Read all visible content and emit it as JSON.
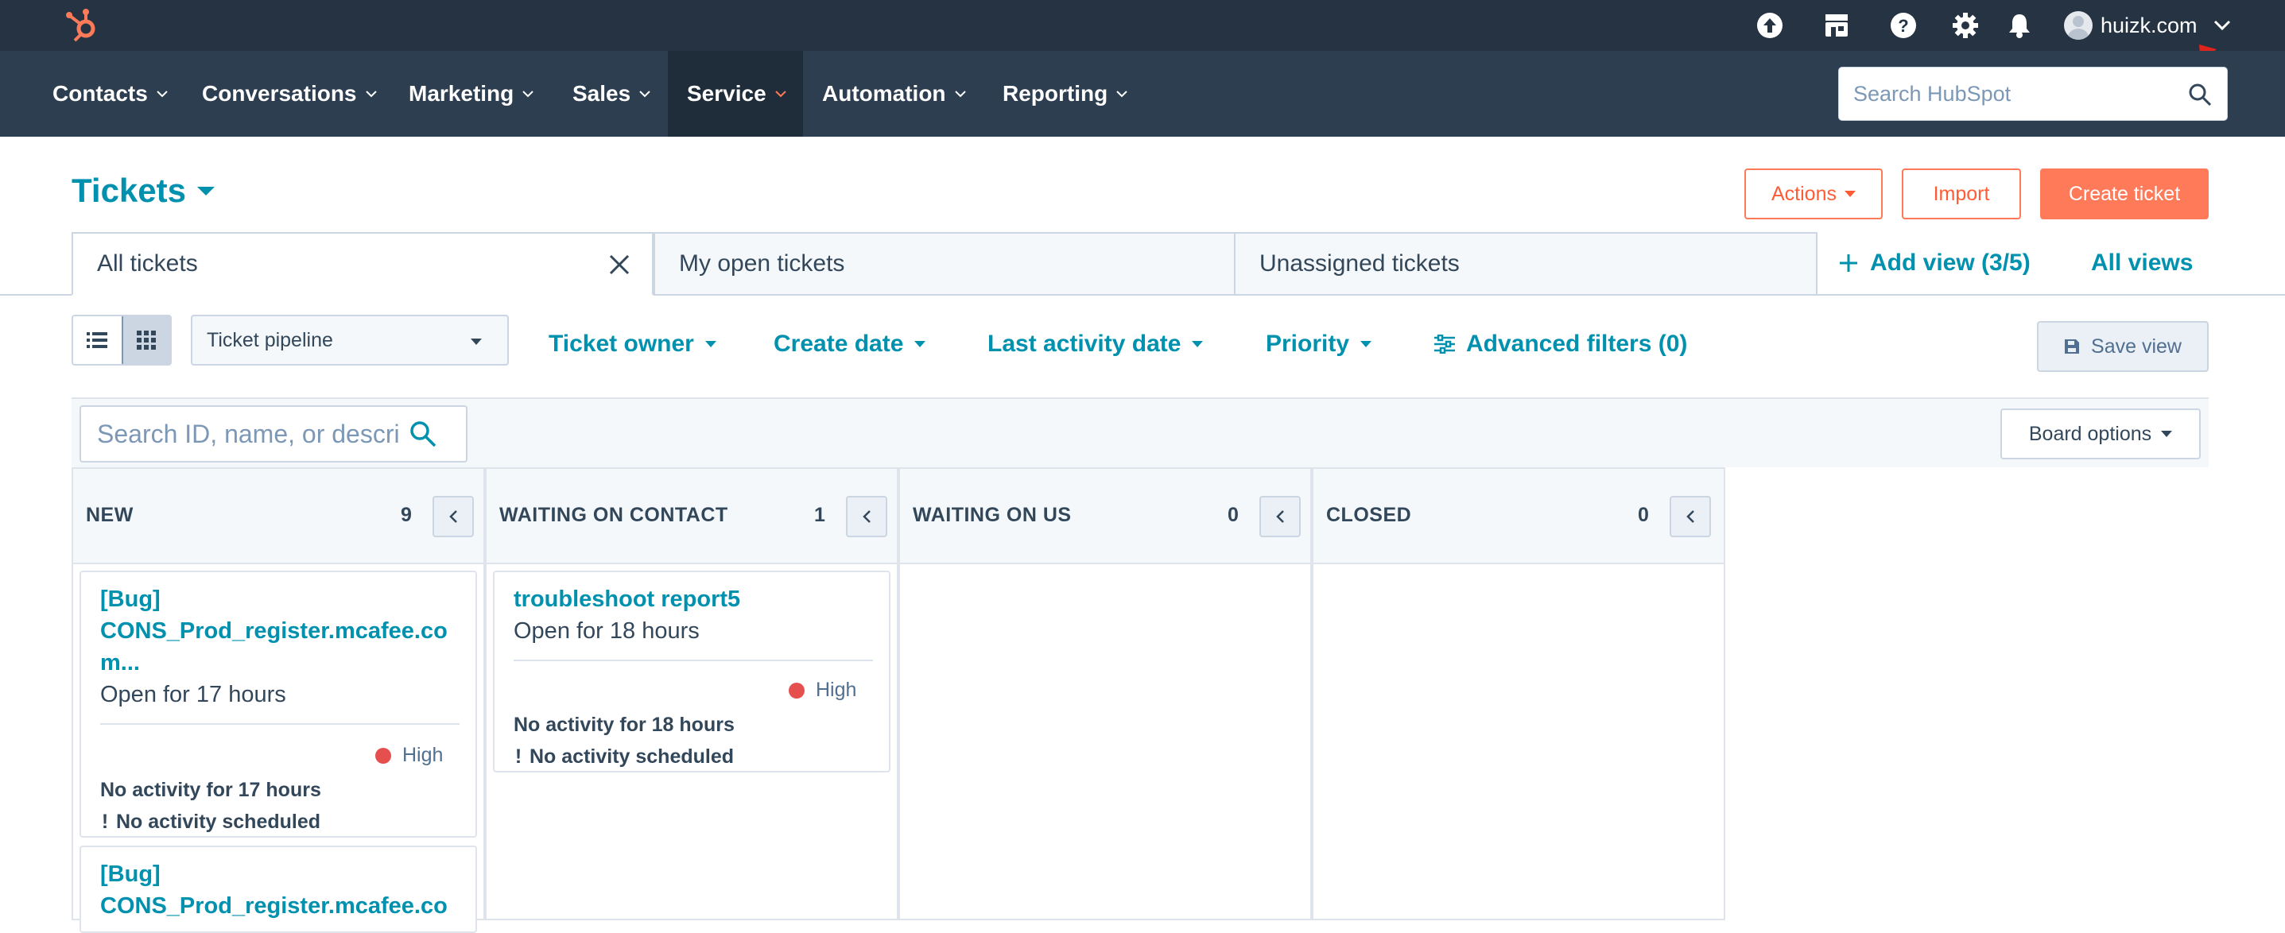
{
  "topbar": {
    "account_name": "huizk.com",
    "icons": [
      "upgrade-icon",
      "marketplace-icon",
      "help-icon",
      "settings-icon",
      "notifications-icon"
    ]
  },
  "nav": {
    "items": [
      {
        "label": "Contacts"
      },
      {
        "label": "Conversations"
      },
      {
        "label": "Marketing"
      },
      {
        "label": "Sales"
      },
      {
        "label": "Service",
        "active": true
      },
      {
        "label": "Automation"
      },
      {
        "label": "Reporting"
      }
    ],
    "search_placeholder": "Search HubSpot"
  },
  "header": {
    "title": "Tickets",
    "actions_label": "Actions",
    "import_label": "Import",
    "create_label": "Create ticket"
  },
  "tabs": {
    "items": [
      {
        "label": "All tickets",
        "active": true
      },
      {
        "label": "My open tickets"
      },
      {
        "label": "Unassigned tickets"
      }
    ],
    "add_view": "Add view (3/5)",
    "all_views": "All views"
  },
  "filters": {
    "pipeline": "Ticket pipeline",
    "owner": "Ticket owner",
    "create_date": "Create date",
    "last_activity": "Last activity date",
    "priority": "Priority",
    "advanced": "Advanced filters (0)",
    "save_view": "Save view"
  },
  "board": {
    "search_placeholder": "Search ID, name, or description",
    "options_label": "Board options",
    "columns": [
      {
        "name": "NEW",
        "count": "9",
        "cards": [
          {
            "title_lines": [
              "[Bug]",
              "CONS_Prod_register.mcafee.co",
              "m..."
            ],
            "open_for": "Open for 17 hours",
            "priority": "High",
            "activity": "No activity for 17 hours",
            "scheduled": "No activity scheduled"
          },
          {
            "title_lines": [
              "[Bug]",
              "CONS_Prod_register.mcafee.co"
            ]
          }
        ]
      },
      {
        "name": "WAITING ON CONTACT",
        "count": "1",
        "cards": [
          {
            "title_lines": [
              "troubleshoot report5"
            ],
            "open_for": "Open for 18 hours",
            "priority": "High",
            "activity": "No activity for 18 hours",
            "scheduled": "No activity scheduled"
          }
        ]
      },
      {
        "name": "WAITING ON US",
        "count": "0",
        "cards": []
      },
      {
        "name": "CLOSED",
        "count": "0",
        "cards": []
      }
    ]
  },
  "colors": {
    "topbar": "#253342",
    "navbar": "#2d3e50",
    "link": "#0091ae",
    "accent": "#ff7a59",
    "priority_high": "#e5504f"
  }
}
